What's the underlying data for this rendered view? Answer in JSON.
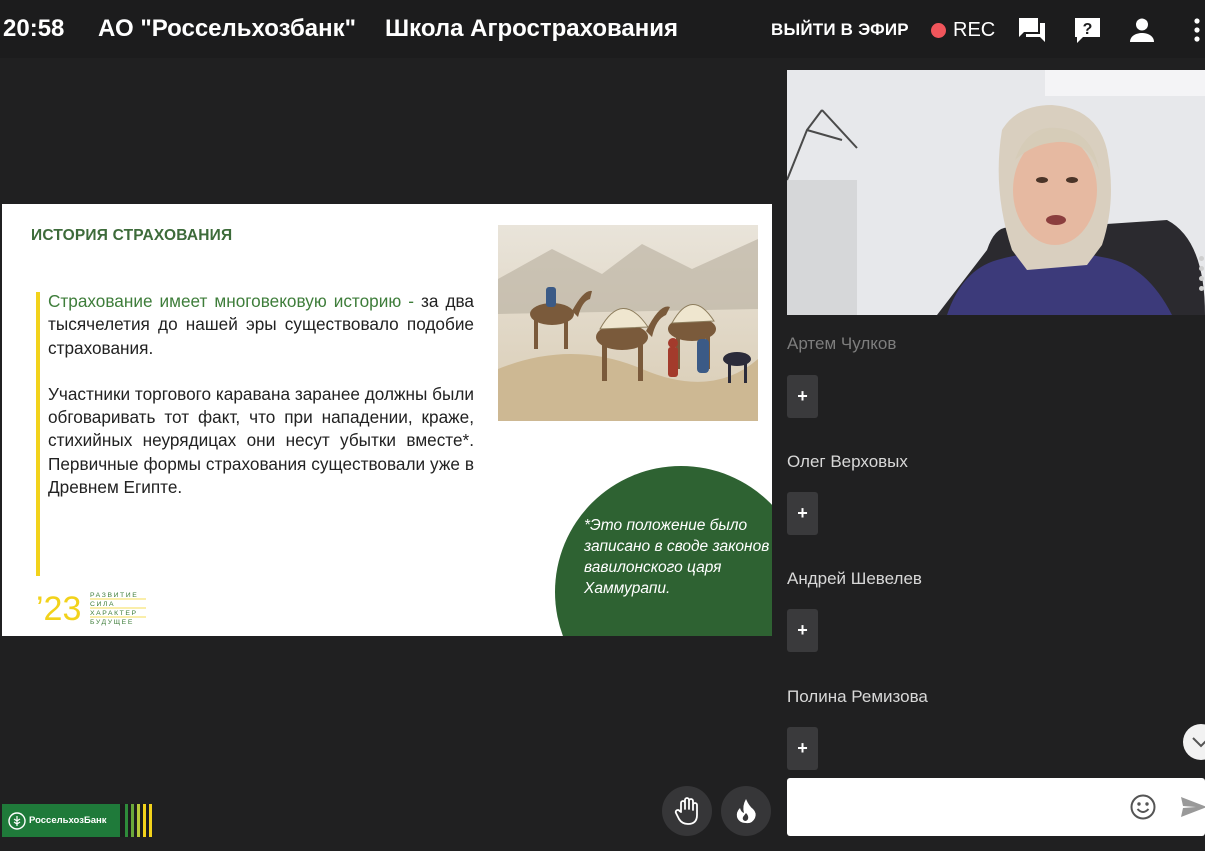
{
  "header": {
    "time": "20:58",
    "org_name": "АО \"Россельхозбанк\"",
    "event_title": "Школа Агрострахования",
    "go_live_label": "ВЫЙТИ В ЭФИР",
    "rec_label": "REC",
    "icons": [
      "chat-icon",
      "question-icon",
      "person-icon",
      "more-vert-icon"
    ]
  },
  "slide": {
    "title": "ИСТОРИЯ СТРАХОВАНИЯ",
    "paragraph1_green": "Страхование имеет многовековую историю -",
    "paragraph1_rest": "за два тысячелетия до нашей эры существовало подобие страхования.",
    "paragraph2": "Участники торгового каравана заранее должны были обговаривать тот факт, что при нападении, краже, стихийных неурядицах они несут убытки вместе*. Первичные формы страхования существовали уже в Древнем Египте.",
    "note": "*Это положение было записано в своде законов вавилонского царя Хаммурапи.",
    "logo_number": "’23",
    "logo_words": [
      "РАЗВИТИЕ",
      "СИЛА",
      "ХАРАКТЕР",
      "БУДУЩЕЕ"
    ],
    "colors": {
      "accent_green": "#3d6b3a",
      "circle_green": "#2e6232",
      "bar_yellow": "#f2d21b"
    }
  },
  "participants": [
    {
      "name": "Артем Чулков",
      "add_label": "+"
    },
    {
      "name": "Олег Верховых",
      "add_label": "+"
    },
    {
      "name": "Андрей Шевелев",
      "add_label": "+"
    },
    {
      "name": "Полина Ремизова",
      "add_label": "+"
    }
  ],
  "chat": {
    "input_value": "",
    "icons": [
      "emoji-icon",
      "send-icon"
    ]
  },
  "controls": {
    "icons": [
      "raise-hand-icon",
      "fire-reaction-icon"
    ]
  },
  "brand": {
    "name": "РоссельхозБанк"
  }
}
